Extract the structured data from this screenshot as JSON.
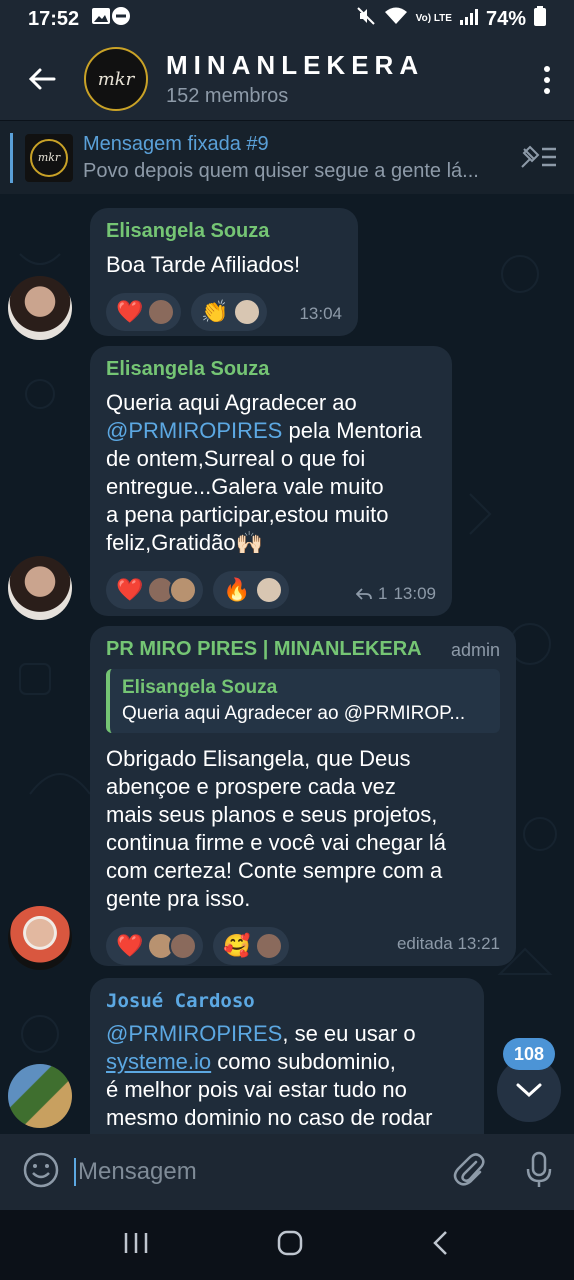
{
  "status_bar": {
    "time": "17:52",
    "battery": "74%",
    "signal_label": "Vo) LTE"
  },
  "header": {
    "title": "MINANLEKERA",
    "members": "152 membros",
    "logo_text": "mkr"
  },
  "pinned": {
    "title": "Mensagem fixada #9",
    "preview": "Povo depois quem quiser segue a gente lá..."
  },
  "messages": [
    {
      "sender": "Elisangela Souza",
      "text": "Boa Tarde Afiliados!",
      "reactions": [
        "❤️",
        "👏"
      ],
      "time": "13:04"
    },
    {
      "sender": "Elisangela Souza",
      "mention": "@PRMIROPIRES",
      "lines": [
        "Queria aqui Agradecer ao",
        "pela Mentoria",
        "de ontem,Surreal o que foi",
        "entregue...Galera vale muito",
        "a pena participar,estou muito",
        "feliz,Gratidão🙌🏻"
      ],
      "reactions": [
        "❤️",
        "🔥"
      ],
      "replies": "1",
      "time": "13:09"
    },
    {
      "sender": "PR MIRO PIRES | MINANLEKERA",
      "role": "admin",
      "quote_name": "Elisangela Souza",
      "quote_text": "Queria aqui Agradecer ao @PRMIROP...",
      "lines": [
        "Obrigado Elisangela, que Deus",
        "abençoe e prospere cada vez",
        "mais seus planos e seus projetos,",
        "continua firme e você vai chegar lá",
        "com certeza! Conte sempre com a",
        "gente pra isso."
      ],
      "reactions": [
        "❤️",
        "🥰"
      ],
      "time": "editada 13:21"
    },
    {
      "sender": "Josué Cardoso",
      "mention": "@PRMIROPIRES",
      "link": "systeme.io",
      "lines": [
        ", se eu usar o",
        "como subdominio,",
        "é melhor pois vai estar tudo no",
        "mesmo dominio no caso de rodar"
      ]
    }
  ],
  "unread_count": "108",
  "composer": {
    "placeholder": "Mensagem"
  },
  "colors": {
    "sender_green": "#75c574",
    "sender_blue": "#5ca8e2",
    "accent": "#4c94d6"
  }
}
